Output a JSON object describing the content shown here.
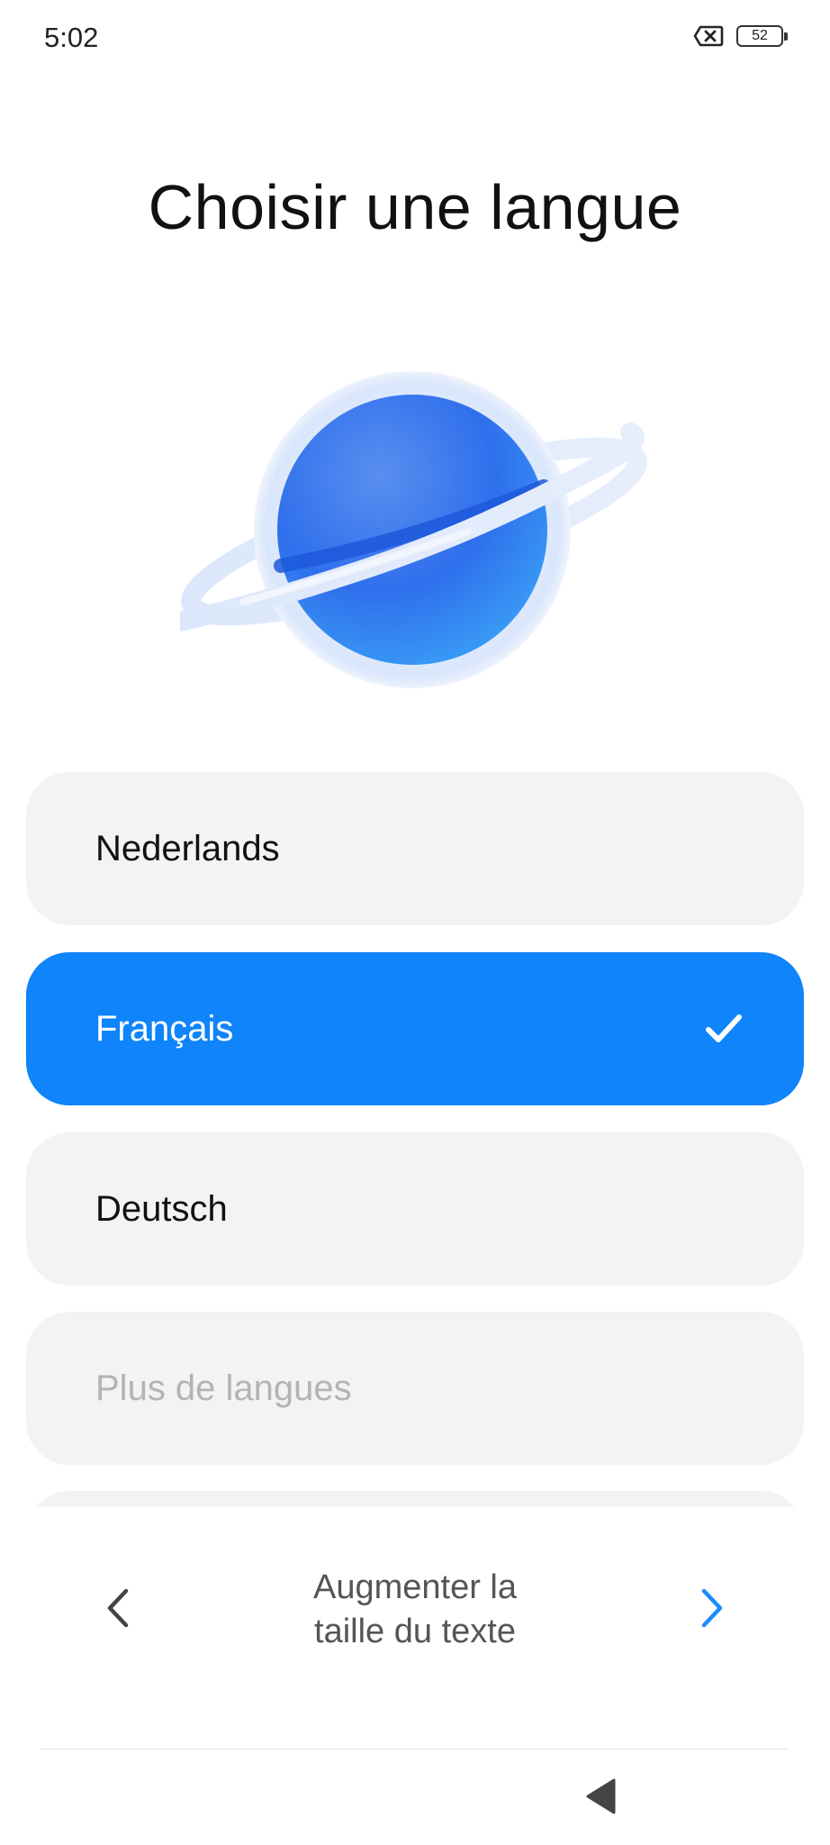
{
  "status_bar": {
    "time": "5:02",
    "battery_level": "52",
    "icons": [
      "no-sim-icon",
      "battery-icon"
    ]
  },
  "page": {
    "title": "Choisir une langue",
    "illustration": "planet-illustration"
  },
  "languages": [
    {
      "label": "Nederlands",
      "selected": false
    },
    {
      "label": "Français",
      "selected": true
    },
    {
      "label": "Deutsch",
      "selected": false
    }
  ],
  "more_languages": "Plus de langues",
  "footer": {
    "text_size_line1": "Augmenter la",
    "text_size_line2": "taille du texte",
    "prev_icon": "chevron-left-icon",
    "next_icon": "chevron-right-icon"
  },
  "nav_bar": {
    "back_icon": "back-triangle-icon"
  },
  "colors": {
    "accent": "#0f84fb",
    "item_background": "#f3f3f3",
    "next_arrow": "#1a8cff"
  }
}
